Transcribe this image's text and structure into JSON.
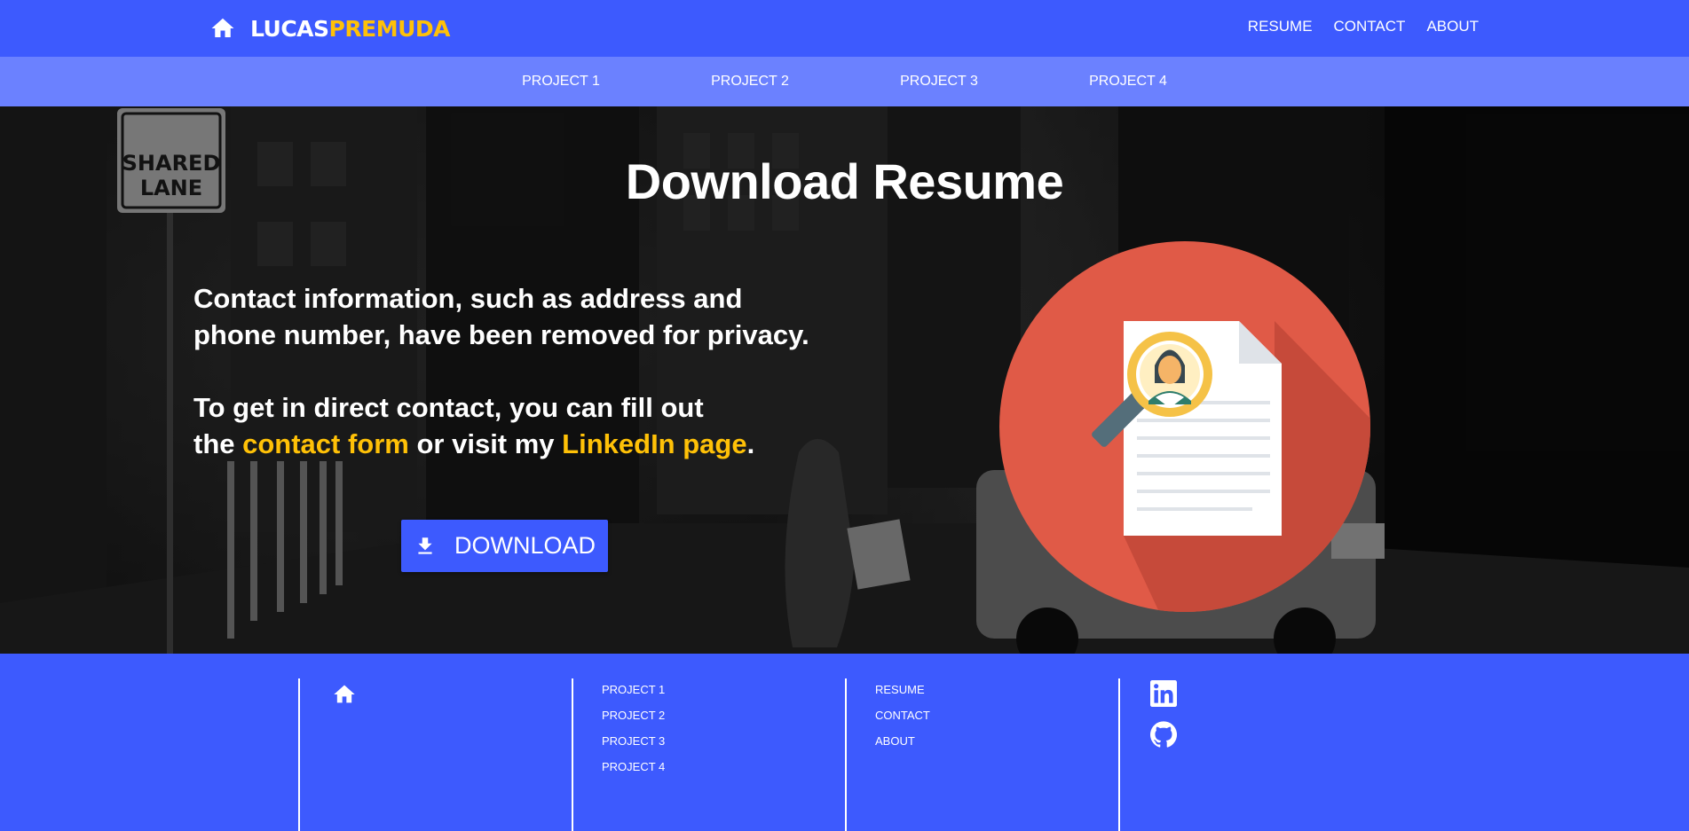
{
  "header": {
    "brand_first": "LUCAS",
    "brand_last": "PREMUDA",
    "home_icon": "home-icon",
    "nav": [
      "RESUME",
      "CONTACT",
      "ABOUT"
    ]
  },
  "subnav": [
    "PROJECT 1",
    "PROJECT 2",
    "PROJECT 3",
    "PROJECT 4"
  ],
  "hero": {
    "title": "Download Resume",
    "privacy_line1": "Contact information, such as address and",
    "privacy_line2": "phone number, have been removed for privacy.",
    "contact_line1": "To get in direct contact, you can fill out",
    "contact_pre": "the ",
    "contact_form_link": "contact form",
    "contact_mid": " or visit my ",
    "linkedin_link": "LinkedIn page",
    "contact_end": ".",
    "download_label": "DOWNLOAD",
    "download_icon": "download-icon"
  },
  "footer": {
    "projects": [
      "PROJECT 1",
      "PROJECT 2",
      "PROJECT 3",
      "PROJECT 4"
    ],
    "pages": [
      "RESUME",
      "CONTACT",
      "ABOUT"
    ],
    "social_icons": [
      "linkedin-icon",
      "github-icon"
    ]
  },
  "colors": {
    "primary": "#3d5afe",
    "secondary": "#6b81ff",
    "accent": "#ffc107",
    "illustration_circle": "#e05a47"
  }
}
